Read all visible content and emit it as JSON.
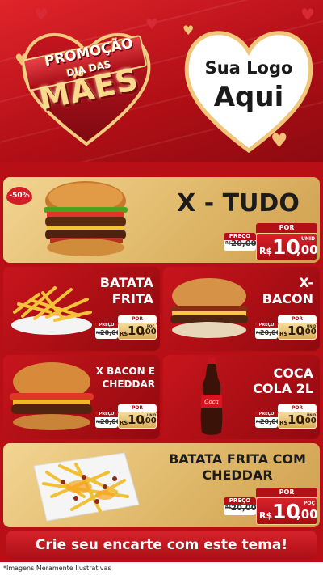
{
  "header": {
    "badge_line1": "PROMOÇÃO",
    "badge_line2": "DIA DAS",
    "badge_line3": "MÃES",
    "logo_line1": "Sua Logo",
    "logo_line2": "Aqui"
  },
  "products": {
    "xtudo": {
      "name": "X - TUDO",
      "discount": "-50%",
      "por": "POR",
      "preco_label": "PREÇO",
      "old_currency": "R$",
      "old_price": "20,00",
      "currency": "R$",
      "price_int": "10",
      "price_cents": ",00",
      "unit": "UNID"
    },
    "batata": {
      "name_line1": "BATATA",
      "name_line2": "FRITA",
      "por": "POR",
      "preco_label": "PREÇO",
      "old_currency": "R$",
      "old_price": "20,00",
      "currency": "R$",
      "price_int": "10",
      "price_cents": ",00",
      "unit": "POÇ"
    },
    "xbacon": {
      "name_line1": "X-",
      "name_line2": "BACON",
      "por": "POR",
      "preco_label": "PREÇO",
      "old_currency": "R$",
      "old_price": "20,00",
      "currency": "R$",
      "price_int": "10",
      "price_cents": ",00",
      "unit": "UNID"
    },
    "xbaconcheddar": {
      "name_line1": "X BACON E",
      "name_line2": "CHEDDAR",
      "por": "POR",
      "preco_label": "PREÇO",
      "old_currency": "R$",
      "old_price": "20,00",
      "currency": "R$",
      "price_int": "10",
      "price_cents": ",00",
      "unit": "UNID"
    },
    "coca": {
      "name_line1": "COCA",
      "name_line2": "COLA 2L",
      "por": "POR",
      "preco_label": "PREÇO",
      "old_currency": "R$",
      "old_price": "20,00",
      "currency": "R$",
      "price_int": "10",
      "price_cents": ",00",
      "unit": "UNID"
    },
    "batatacheddar": {
      "name_line1": "BATATA FRITA COM",
      "name_line2": "CHEDDAR",
      "por": "POR",
      "preco_label": "PREÇO",
      "old_currency": "R$",
      "old_price": "20,00",
      "currency": "R$",
      "price_int": "10",
      "price_cents": ",00",
      "unit": "POÇ"
    }
  },
  "cta": "Crie seu encarte com este tema!",
  "disclaimer": "*Imagens Meramente Ilustrativas",
  "colors": {
    "red": "#b80f16",
    "gold": "#e0b86a",
    "cream": "#f6dc9c"
  }
}
